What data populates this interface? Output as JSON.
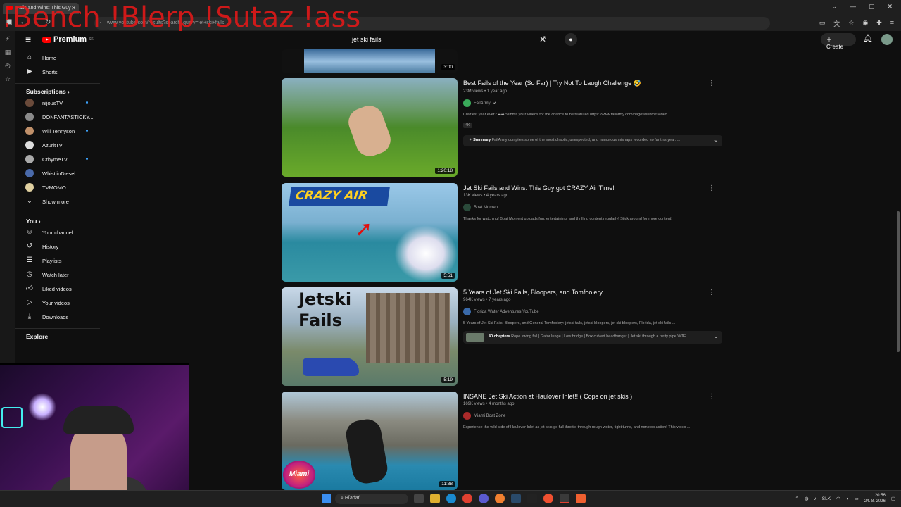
{
  "browser": {
    "tab_title": "Fails and Wins: This Guy",
    "url": "www.youtube.com/results?search_query=jet+ski+fails",
    "overlay": "!Bench !Blerp !Sutaz !ass"
  },
  "header": {
    "logo_text": "Premium",
    "logo_sup": "SK",
    "search_value": "jet ski fails",
    "create_label": "Create"
  },
  "sidebar": {
    "home": "Home",
    "shorts": "Shorts",
    "subscriptions_title": "Subscriptions",
    "channels": [
      {
        "name": "nijousTV",
        "dot": true,
        "color": "#6a4a3a"
      },
      {
        "name": "DONFANTASTICKY...",
        "dot": false,
        "color": "#8a8a8a"
      },
      {
        "name": "Will Tennyson",
        "dot": true,
        "color": "#c0906a"
      },
      {
        "name": "AzuritTV",
        "dot": false,
        "color": "#dddddd"
      },
      {
        "name": "CrhymeTV",
        "dot": true,
        "color": "#aaaaaa"
      },
      {
        "name": "WhistlinDiesel",
        "dot": false,
        "color": "#4a6aaa"
      },
      {
        "name": "TVMOMO",
        "dot": false,
        "color": "#e0d0a0"
      }
    ],
    "show_more": "Show more",
    "you_title": "You",
    "you_items": [
      "Your channel",
      "History",
      "Playlists",
      "Watch later",
      "Liked videos",
      "Your videos",
      "Downloads"
    ],
    "explore_title": "Explore"
  },
  "results": [
    {
      "title": "",
      "duration": "3:00"
    },
    {
      "title": "Best Fails of the Year (So Far) | Try Not To Laugh Challenge",
      "views": "23M views",
      "age": "1 year ago",
      "channel": "FailArmy",
      "channel_color": "#3aaa5a",
      "desc": "Craziest year ever? ➡➡ Submit your videos for the chance to be featured https://www.failarmy.com/pages/submit-video ...",
      "badge": "4K",
      "summary_label": "Summary",
      "summary_text": "FailArmy compiles some of the most chaotic, unexpected, and humorous mishaps recorded so far this year. ...",
      "duration": "1:20:18"
    },
    {
      "title": "Jet Ski Fails and Wins: This Guy got CRAZY Air Time!",
      "views": "13K views",
      "age": "4 years ago",
      "channel": "Boat Moment",
      "channel_color": "#2a4a3a",
      "desc": "Thanks for watching! Boat Moment uploads fun, entertaining, and thrilling content regularly! Stick around for more content!",
      "thumb_text": "CRAZY AIR",
      "duration": "5:51"
    },
    {
      "title": "5 Years of Jet Ski Fails, Bloopers, and Tomfoolery",
      "views": "964K views",
      "age": "7 years ago",
      "channel": "Florida Water Adventures YouTube",
      "channel_color": "#3a6aaa",
      "desc": "5 Years of Jet Ski Fails, Bloopers, and General Tomfoolery: jetski fails, jetski bloopers, jet ski bloopers, Florida, jet ski fails ...",
      "chapters_label": "40 chapters",
      "chapters_text": "Rope swing fail | Gator lunge | Low bridge | Box culvert headbanger | Jet ski through a rusty pipe WTF ...",
      "thumb_text_1": "Jetski",
      "thumb_text_2": "Fails",
      "duration": "5:19"
    },
    {
      "title": "INSANE Jet Ski Action at Haulover Inlet!! ( Cops on jet skis )",
      "views": "169K views",
      "age": "4 months ago",
      "channel": "Miami Boat Zone",
      "channel_color": "#aa2a2a",
      "desc": "Experience the wild side of Haulover Inlet as jet skis go full throttle through rough water, tight turns, and nonstop action! This video ...",
      "thumb_logo": "Miami",
      "duration": "11:38"
    }
  ],
  "taskbar": {
    "search_placeholder": "Hľadať",
    "lang": "SLK",
    "time": "20:56",
    "date": "24. 8. 2026"
  },
  "colors": {
    "bg": "#0f0f0f",
    "brand_red": "#ff0000",
    "overlay_red": "#e11919",
    "accent_blue": "#3ea6ff"
  }
}
